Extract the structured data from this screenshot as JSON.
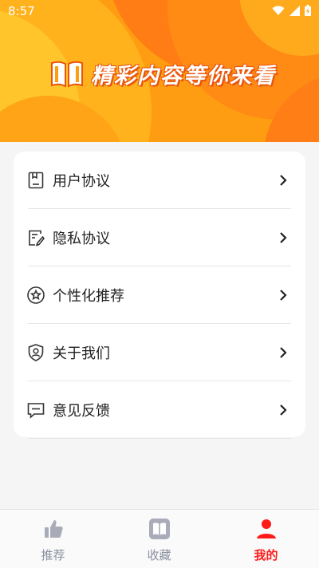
{
  "status": {
    "time": "8:57"
  },
  "banner": {
    "slogan": "精彩内容等你来看"
  },
  "menu": {
    "items": [
      {
        "label": "用户协议",
        "icon": "document-icon"
      },
      {
        "label": "隐私协议",
        "icon": "edit-document-icon"
      },
      {
        "label": "个性化推荐",
        "icon": "star-icon"
      },
      {
        "label": "关于我们",
        "icon": "shield-user-icon"
      },
      {
        "label": "意见反馈",
        "icon": "message-icon"
      }
    ]
  },
  "tabs": [
    {
      "label": "推荐",
      "icon": "thumbs-up-icon",
      "active": false
    },
    {
      "label": "收藏",
      "icon": "book-icon",
      "active": false
    },
    {
      "label": "我的",
      "icon": "user-icon",
      "active": true
    }
  ],
  "colors": {
    "accent": "#ff1a1a",
    "banner": "#ff9d12"
  }
}
